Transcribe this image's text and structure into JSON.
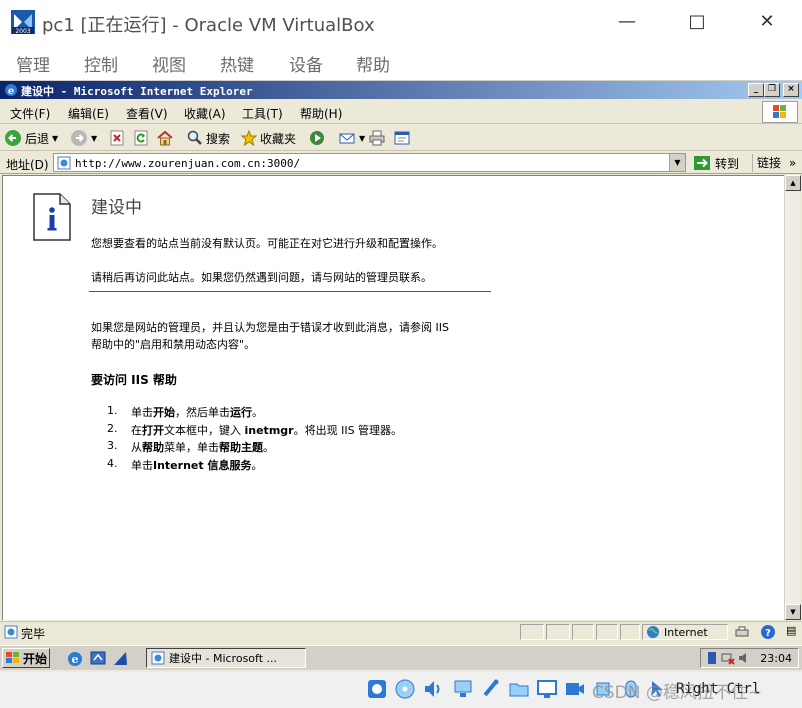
{
  "vbox": {
    "title": "pc1 [正在运行] - Oracle VM VirtualBox",
    "icon_badge": "2003",
    "menu": [
      "管理",
      "控制",
      "视图",
      "热键",
      "设备",
      "帮助"
    ],
    "host_key": "Right Ctrl",
    "watermark": "CSDN @稳风扭不住~"
  },
  "ie": {
    "title": "建设中 - Microsoft Internet Explorer",
    "menu": [
      "文件(F)",
      "编辑(E)",
      "查看(V)",
      "收藏(A)",
      "工具(T)",
      "帮助(H)"
    ],
    "toolbar": {
      "back_label": "后退",
      "search_label": "搜索",
      "favorites_label": "收藏夹"
    },
    "address": {
      "label": "地址(D)",
      "url": "http://www.zourenjuan.com.cn:3000/",
      "go_label": "转到",
      "links_label": "链接"
    },
    "status": {
      "text": "完毕",
      "zone": "Internet"
    }
  },
  "page": {
    "title": "建设中",
    "p1": "您想要查看的站点当前没有默认页。可能正在对它进行升级和配置操作。",
    "p2": "请稍后再访问此站点。如果您仍然遇到问题，请与网站的管理员联系。",
    "p3_line1": "如果您是网站的管理员，并且认为您是由于错误才收到此消息，请参阅 IIS",
    "p3_line2": "帮助中的\"启用和禁用动态内容\"。",
    "subhead": "要访问 IIS 帮助",
    "steps": [
      {
        "num": "1.",
        "pre": "单击",
        "b1": "开始",
        "mid": "，然后单击",
        "b2": "运行",
        "post": "。"
      },
      {
        "num": "2.",
        "pre": "在",
        "b1": "打开",
        "mid": "文本框中，键入 ",
        "b2": "inetmgr",
        "post": "。将出现 IIS 管理器。"
      },
      {
        "num": "3.",
        "pre": "从",
        "b1": "帮助",
        "mid": "菜单，单击",
        "b2": "帮助主题",
        "post": "。"
      },
      {
        "num": "4.",
        "pre": "单击",
        "b1": "Internet 信息服务",
        "mid": "。",
        "b2": "",
        "post": ""
      }
    ]
  },
  "taskbar": {
    "start_label": "开始",
    "task_label": "建设中 - Microsoft ...",
    "clock": "23:04"
  },
  "colors": {
    "ie_title_start": "#0a246a",
    "ie_title_end": "#a6caf0",
    "rule": "#3a4fc7",
    "chrome": "#ece9d8"
  }
}
